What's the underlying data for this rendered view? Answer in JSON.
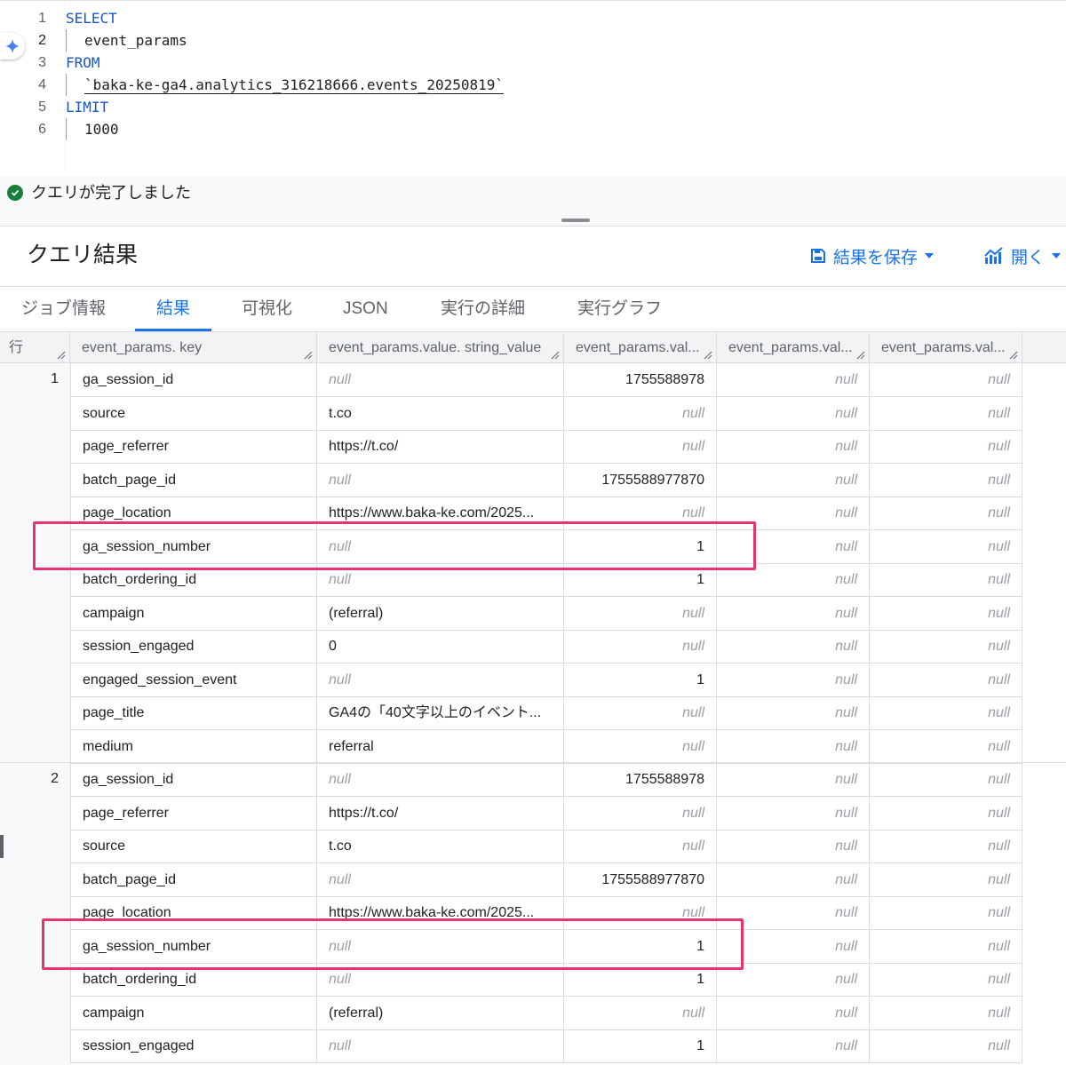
{
  "editor": {
    "lines": [
      {
        "n": "1",
        "kw": "SELECT"
      },
      {
        "n": "2",
        "text": "event_params"
      },
      {
        "n": "3",
        "kw": "FROM"
      },
      {
        "n": "4",
        "text": "`baka-ke-ga4.analytics_316218666.events_20250819`"
      },
      {
        "n": "5",
        "kw": "LIMIT"
      },
      {
        "n": "6",
        "num": "1000"
      }
    ]
  },
  "status": {
    "text": "クエリが完了しました"
  },
  "results": {
    "title": "クエリ結果",
    "save_label": "結果を保存",
    "open_label": "開く"
  },
  "tabs": [
    "ジョブ情報",
    "結果",
    "可視化",
    "JSON",
    "実行の詳細",
    "実行グラフ"
  ],
  "grid": {
    "columns": [
      "行",
      "event_params. key",
      "event_params.value. string_value",
      "event_params.val...",
      "event_params.val...",
      "event_params.val..."
    ],
    "null_text": "null",
    "groups": [
      {
        "row_number": "1",
        "rows": [
          [
            "ga_session_id",
            null,
            "1755588978"
          ],
          [
            "source",
            "t.co",
            null
          ],
          [
            "page_referrer",
            "https://t.co/",
            null
          ],
          [
            "batch_page_id",
            null,
            "1755588977870"
          ],
          [
            "page_location",
            "https://www.baka-ke.com/2025...",
            null
          ],
          [
            "ga_session_number",
            null,
            "1"
          ],
          [
            "batch_ordering_id",
            null,
            "1"
          ],
          [
            "campaign",
            "(referral)",
            null
          ],
          [
            "session_engaged",
            "0",
            null
          ],
          [
            "engaged_session_event",
            null,
            "1"
          ],
          [
            "page_title",
            "GA4の「40文字以上のイベント...",
            null
          ],
          [
            "medium",
            "referral",
            null
          ]
        ]
      },
      {
        "row_number": "2",
        "rows": [
          [
            "ga_session_id",
            null,
            "1755588978"
          ],
          [
            "page_referrer",
            "https://t.co/",
            null
          ],
          [
            "source",
            "t.co",
            null
          ],
          [
            "batch_page_id",
            null,
            "1755588977870"
          ],
          [
            "page_location",
            "https://www.baka-ke.com/2025...",
            null
          ],
          [
            "ga_session_number",
            null,
            "1"
          ],
          [
            "batch_ordering_id",
            null,
            "1"
          ],
          [
            "campaign",
            "(referral)",
            null
          ],
          [
            "session_engaged",
            null,
            "1"
          ]
        ]
      }
    ]
  },
  "colors": {
    "accent": "#1a73e8",
    "success": "#188038",
    "highlight": "#e8336d",
    "keyword": "#1a57c4",
    "number": "#b55a00"
  }
}
